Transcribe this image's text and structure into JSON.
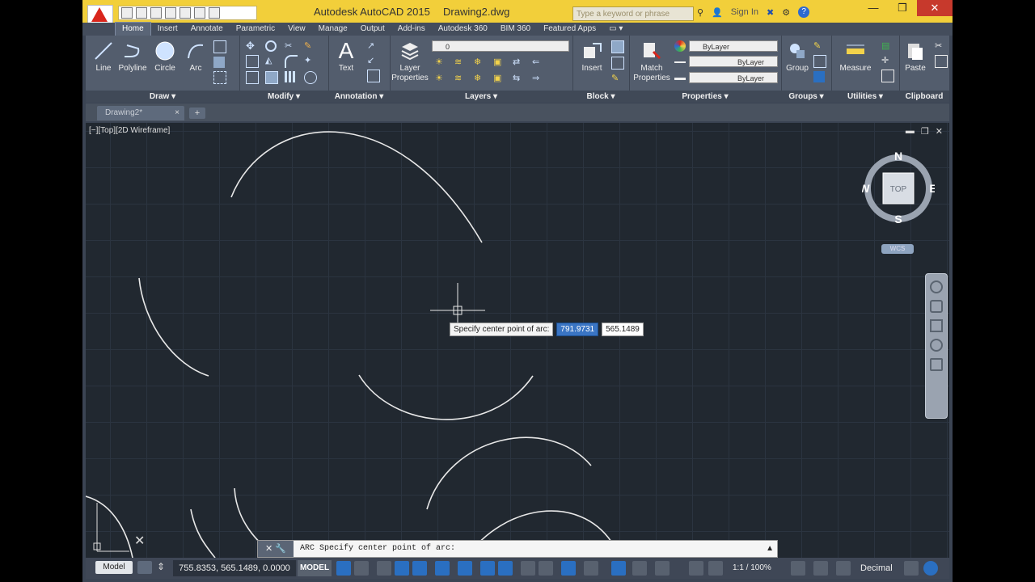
{
  "app": {
    "title": "Autodesk AutoCAD 2015",
    "document": "Drawing2.dwg",
    "search_placeholder": "Type a keyword or phrase",
    "sign_in": "Sign In"
  },
  "ribbon_tabs": [
    "Home",
    "Insert",
    "Annotate",
    "Parametric",
    "View",
    "Manage",
    "Output",
    "Add-ins",
    "Autodesk 360",
    "BIM 360",
    "Featured Apps"
  ],
  "ribbon": {
    "draw": {
      "title": "Draw",
      "line": "Line",
      "polyline": "Polyline",
      "circle": "Circle",
      "arc": "Arc"
    },
    "modify": {
      "title": "Modify"
    },
    "annotation": {
      "title": "Annotation",
      "text": "Text"
    },
    "layers": {
      "title": "Layers",
      "layer_properties": "Layer Properties",
      "current_layer": "0"
    },
    "block": {
      "title": "Block",
      "insert": "Insert"
    },
    "properties": {
      "title": "Properties",
      "match_properties": "Match Properties",
      "color": "ByLayer",
      "linetype": "ByLayer",
      "lineweight": "ByLayer"
    },
    "groups": {
      "title": "Groups",
      "group": "Group"
    },
    "utilities": {
      "title": "Utilities",
      "measure": "Measure"
    },
    "clipboard": {
      "title": "Clipboard",
      "paste": "Paste"
    }
  },
  "doc_tab": {
    "label": "Drawing2*"
  },
  "viewport": {
    "label": "[−][Top][2D Wireframe]"
  },
  "viewcube": {
    "n": "N",
    "s": "S",
    "e": "E",
    "w": "W",
    "face": "TOP",
    "wcs": "WCS"
  },
  "tooltip": {
    "prompt": "Specify center point of arc:",
    "x": "791.9731",
    "y": "565.1489"
  },
  "command": {
    "text": "ARC Specify center point of arc:"
  },
  "status": {
    "model_tab": "Model",
    "coords": "755.8353, 565.1489, 0.0000",
    "model": "MODEL",
    "scale": "1:1 / 100%",
    "units": "Decimal"
  }
}
